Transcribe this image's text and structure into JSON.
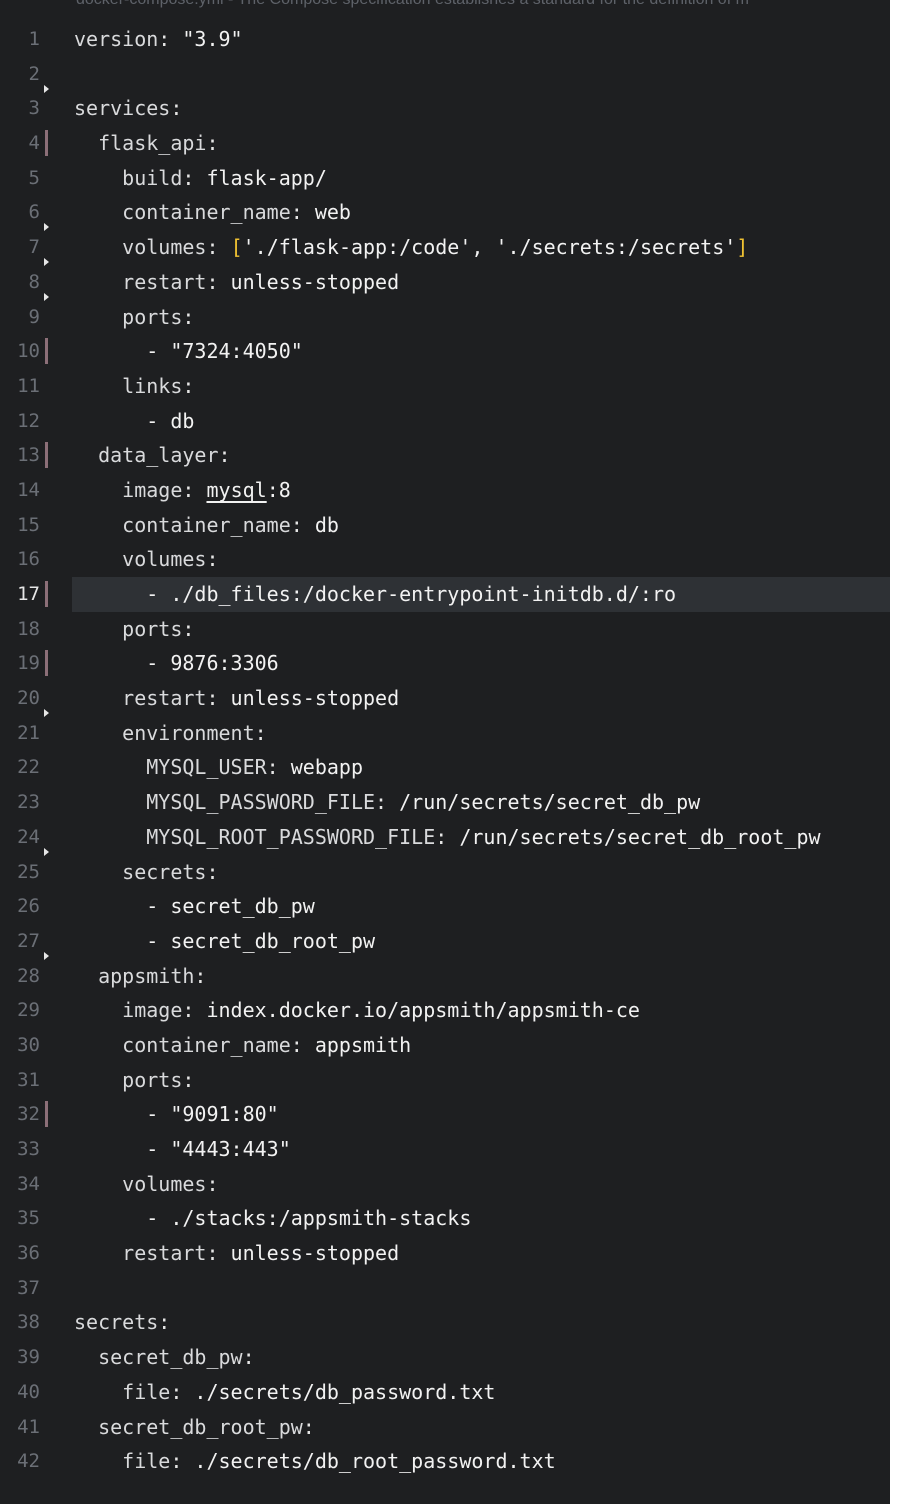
{
  "breadcrumb": "docker-compose.yml - The Compose specification establishes a standard for the definition of m",
  "colors": {
    "background": "#1e1f21",
    "active_line": "#2e3135",
    "gutter_text": "#6b6f76",
    "git_modified": "#8c6f78",
    "bracket": "#f0c232"
  },
  "lines": [
    {
      "n": "1",
      "indent": "",
      "key": "version",
      "sep": ":",
      "val": " \"3.9\""
    },
    {
      "n": "2",
      "indent": "",
      "key": "",
      "sep": "",
      "val": "",
      "fold": true
    },
    {
      "n": "3",
      "indent": "",
      "key": "services",
      "sep": ":",
      "val": ""
    },
    {
      "n": "4",
      "indent": "  ",
      "key": "flask_api",
      "sep": ":",
      "val": "",
      "mod": true
    },
    {
      "n": "5",
      "indent": "    ",
      "key": "build",
      "sep": ":",
      "val": " flask-app/"
    },
    {
      "n": "6",
      "indent": "    ",
      "key": "container_name",
      "sep": ":",
      "val": " web",
      "fold": true
    },
    {
      "n": "7",
      "indent": "    ",
      "key": "volumes",
      "sep": ":",
      "val": " ",
      "br_open": "[",
      "val2": "'./flask-app:/code', './secrets:/secrets'",
      "br_close": "]",
      "fold": true
    },
    {
      "n": "8",
      "indent": "    ",
      "key": "restart",
      "sep": ":",
      "val": " unless-stopped",
      "fold": true
    },
    {
      "n": "9",
      "indent": "    ",
      "key": "ports",
      "sep": ":",
      "val": ""
    },
    {
      "n": "10",
      "indent": "      ",
      "key": "",
      "sep": "",
      "val": "- \"7324:4050\"",
      "mod": true
    },
    {
      "n": "11",
      "indent": "    ",
      "key": "links",
      "sep": ":",
      "val": ""
    },
    {
      "n": "12",
      "indent": "      ",
      "key": "",
      "sep": "",
      "val": "- db"
    },
    {
      "n": "13",
      "indent": "  ",
      "key": "data_layer",
      "sep": ":",
      "val": "",
      "mod": true
    },
    {
      "n": "14",
      "indent": "    ",
      "key": "image",
      "sep": ":",
      "val": " ",
      "u": "mysql",
      "val2": ":8"
    },
    {
      "n": "15",
      "indent": "    ",
      "key": "container_name",
      "sep": ":",
      "val": " db"
    },
    {
      "n": "16",
      "indent": "    ",
      "key": "volumes",
      "sep": ":",
      "val": ""
    },
    {
      "n": "17",
      "indent": "      ",
      "key": "",
      "sep": "",
      "val": "- ./db_files:/docker-entrypoint-initdb.d/:ro",
      "mod": true,
      "active": true
    },
    {
      "n": "18",
      "indent": "    ",
      "key": "ports",
      "sep": ":",
      "val": ""
    },
    {
      "n": "19",
      "indent": "      ",
      "key": "",
      "sep": "",
      "val": "- 9876:3306",
      "mod": true
    },
    {
      "n": "20",
      "indent": "    ",
      "key": "restart",
      "sep": ":",
      "val": " unless-stopped",
      "fold": true
    },
    {
      "n": "21",
      "indent": "    ",
      "key": "environment",
      "sep": ":",
      "val": ""
    },
    {
      "n": "22",
      "indent": "      ",
      "key": "MYSQL_USER",
      "sep": ":",
      "val": " webapp"
    },
    {
      "n": "23",
      "indent": "      ",
      "key": "MYSQL_PASSWORD_FILE",
      "sep": ":",
      "val": " /run/secrets/secret_db_pw"
    },
    {
      "n": "24",
      "indent": "      ",
      "key": "MYSQL_ROOT_PASSWORD_FILE",
      "sep": ":",
      "val": " /run/secrets/secret_db_root_pw",
      "fold": true
    },
    {
      "n": "25",
      "indent": "    ",
      "key": "secrets",
      "sep": ":",
      "val": ""
    },
    {
      "n": "26",
      "indent": "      ",
      "key": "",
      "sep": "",
      "val": "- secret_db_pw"
    },
    {
      "n": "27",
      "indent": "      ",
      "key": "",
      "sep": "",
      "val": "- secret_db_root_pw",
      "fold": true
    },
    {
      "n": "28",
      "indent": "  ",
      "key": "appsmith",
      "sep": ":",
      "val": ""
    },
    {
      "n": "29",
      "indent": "    ",
      "key": "image",
      "sep": ":",
      "val": " index.docker.io/appsmith/appsmith-ce"
    },
    {
      "n": "30",
      "indent": "    ",
      "key": "container_name",
      "sep": ":",
      "val": " appsmith"
    },
    {
      "n": "31",
      "indent": "    ",
      "key": "ports",
      "sep": ":",
      "val": ""
    },
    {
      "n": "32",
      "indent": "      ",
      "key": "",
      "sep": "",
      "val": "- \"9091:80\"",
      "mod": true
    },
    {
      "n": "33",
      "indent": "      ",
      "key": "",
      "sep": "",
      "val": "- \"4443:443\""
    },
    {
      "n": "34",
      "indent": "    ",
      "key": "volumes",
      "sep": ":",
      "val": ""
    },
    {
      "n": "35",
      "indent": "      ",
      "key": "",
      "sep": "",
      "val": "- ./stacks:/appsmith-stacks"
    },
    {
      "n": "36",
      "indent": "    ",
      "key": "restart",
      "sep": ":",
      "val": " unless-stopped"
    },
    {
      "n": "37",
      "indent": "",
      "key": "",
      "sep": "",
      "val": ""
    },
    {
      "n": "38",
      "indent": "",
      "key": "secrets",
      "sep": ":",
      "val": ""
    },
    {
      "n": "39",
      "indent": "  ",
      "key": "secret_db_pw",
      "sep": ":",
      "val": ""
    },
    {
      "n": "40",
      "indent": "    ",
      "key": "file",
      "sep": ":",
      "val": " ./secrets/db_password.txt"
    },
    {
      "n": "41",
      "indent": "  ",
      "key": "secret_db_root_pw",
      "sep": ":",
      "val": ""
    },
    {
      "n": "42",
      "indent": "    ",
      "key": "file",
      "sep": ":",
      "val": " ./secrets/db_root_password.txt"
    }
  ]
}
